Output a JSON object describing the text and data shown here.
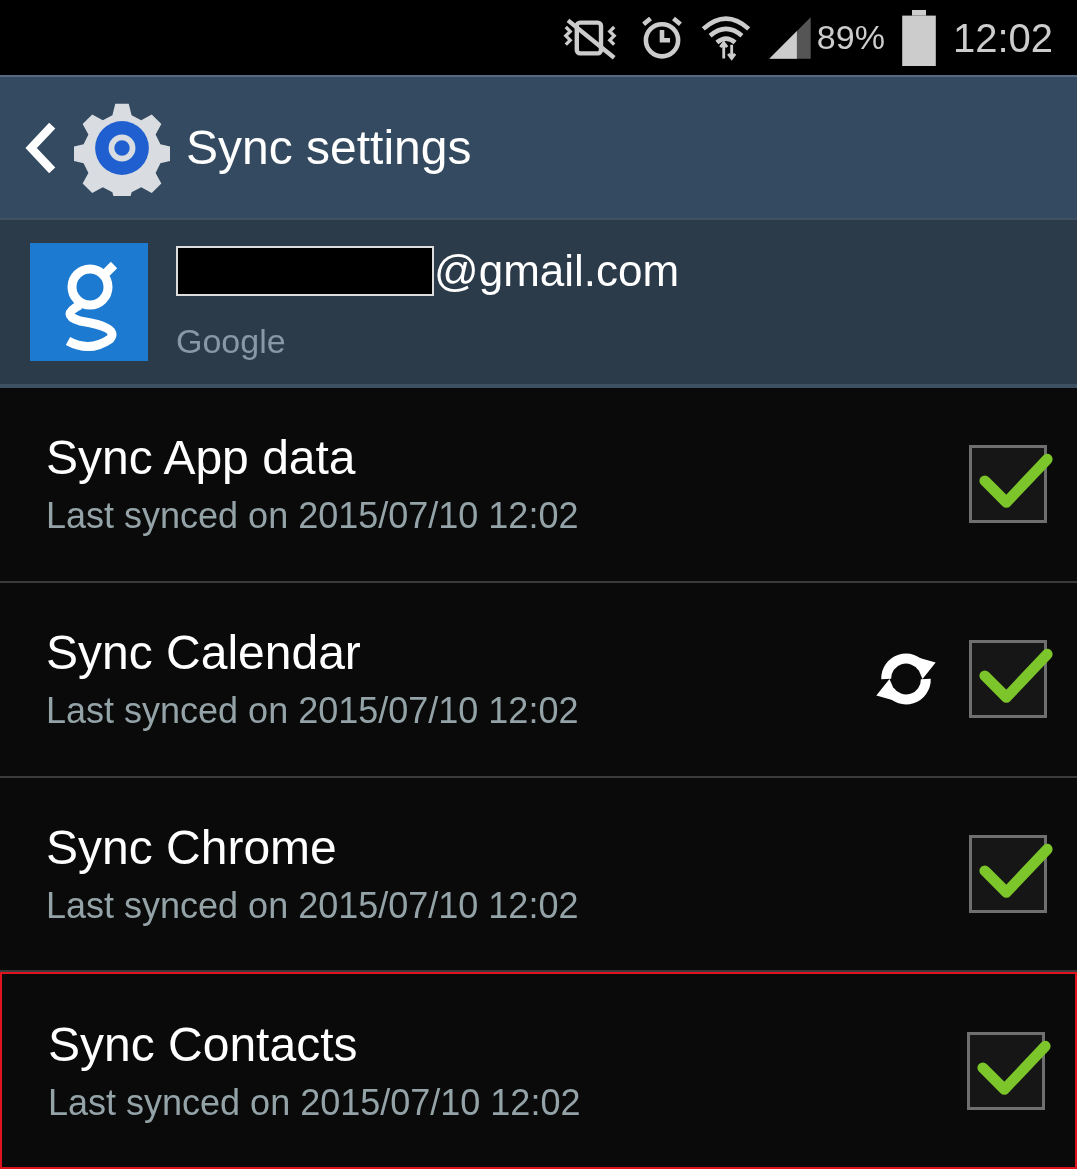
{
  "status_bar": {
    "battery": "89%",
    "time": "12:02"
  },
  "header": {
    "title": "Sync settings"
  },
  "account": {
    "email": "@gmail.com",
    "redacted": true,
    "type": "Google"
  },
  "items": [
    {
      "title": "Sync App data",
      "subtitle": "Last synced on 2015/07/10 12:02",
      "checked": true,
      "syncing": false,
      "highlighted": false
    },
    {
      "title": "Sync Calendar",
      "subtitle": "Last synced on 2015/07/10 12:02",
      "checked": true,
      "syncing": true,
      "highlighted": false
    },
    {
      "title": "Sync Chrome",
      "subtitle": "Last synced on 2015/07/10 12:02",
      "checked": true,
      "syncing": false,
      "highlighted": false
    },
    {
      "title": "Sync Contacts",
      "subtitle": "Last synced on 2015/07/10 12:02",
      "checked": true,
      "syncing": false,
      "highlighted": true
    }
  ]
}
